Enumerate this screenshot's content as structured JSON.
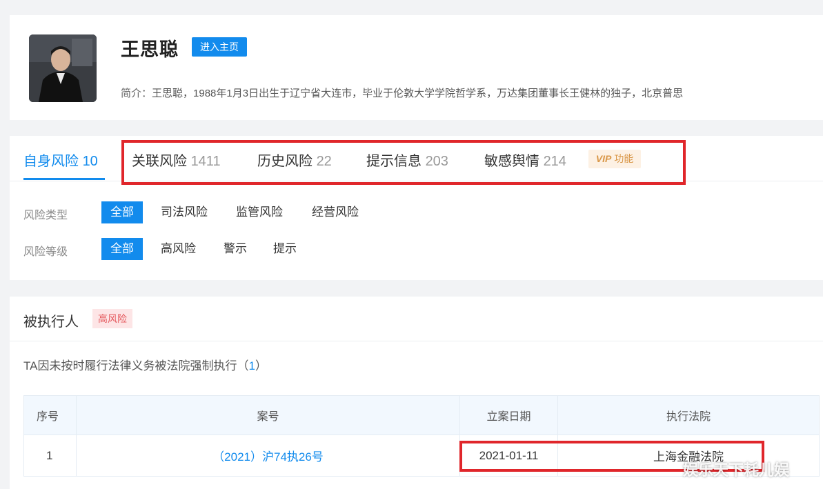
{
  "profile": {
    "name": "王思聪",
    "home_button": "进入主页",
    "bio_label": "简介：",
    "bio_text": "王思聪，1988年1月3日出生于辽宁省大连市，毕业于伦敦大学学院哲学系，万达集团董事长王健林的独子，北京普思"
  },
  "tabs": [
    {
      "label": "自身风险",
      "count": "10",
      "active": true
    },
    {
      "label": "关联风险",
      "count": "1411"
    },
    {
      "label": "历史风险",
      "count": "22"
    },
    {
      "label": "提示信息",
      "count": "203"
    },
    {
      "label": "敏感舆情",
      "count": "214"
    }
  ],
  "vip_badge": {
    "vip": "VIP",
    "text": "功能"
  },
  "filters": {
    "type": {
      "label": "风险类型",
      "options": [
        "全部",
        "司法风险",
        "监管风险",
        "经营风险"
      ],
      "selected": "全部"
    },
    "level": {
      "label": "风险等级",
      "options": [
        "全部",
        "高风险",
        "警示",
        "提示"
      ],
      "selected": "全部"
    }
  },
  "execution": {
    "title": "被执行人",
    "tag": "高风险",
    "desc_prefix": "TA因未按时履行法律义务被法院强制执行（",
    "desc_count": "1",
    "desc_suffix": "）",
    "columns": [
      "序号",
      "案号",
      "立案日期",
      "执行法院"
    ],
    "rows": [
      {
        "no": "1",
        "case_no": "（2021）沪74执26号",
        "date": "2021-01-11",
        "court": "上海金融法院"
      }
    ]
  },
  "colors": {
    "accent": "#128bed",
    "highlight": "#e0262b",
    "risk": "#e55a5f"
  },
  "watermark": "娱乐天下耗儿娱"
}
